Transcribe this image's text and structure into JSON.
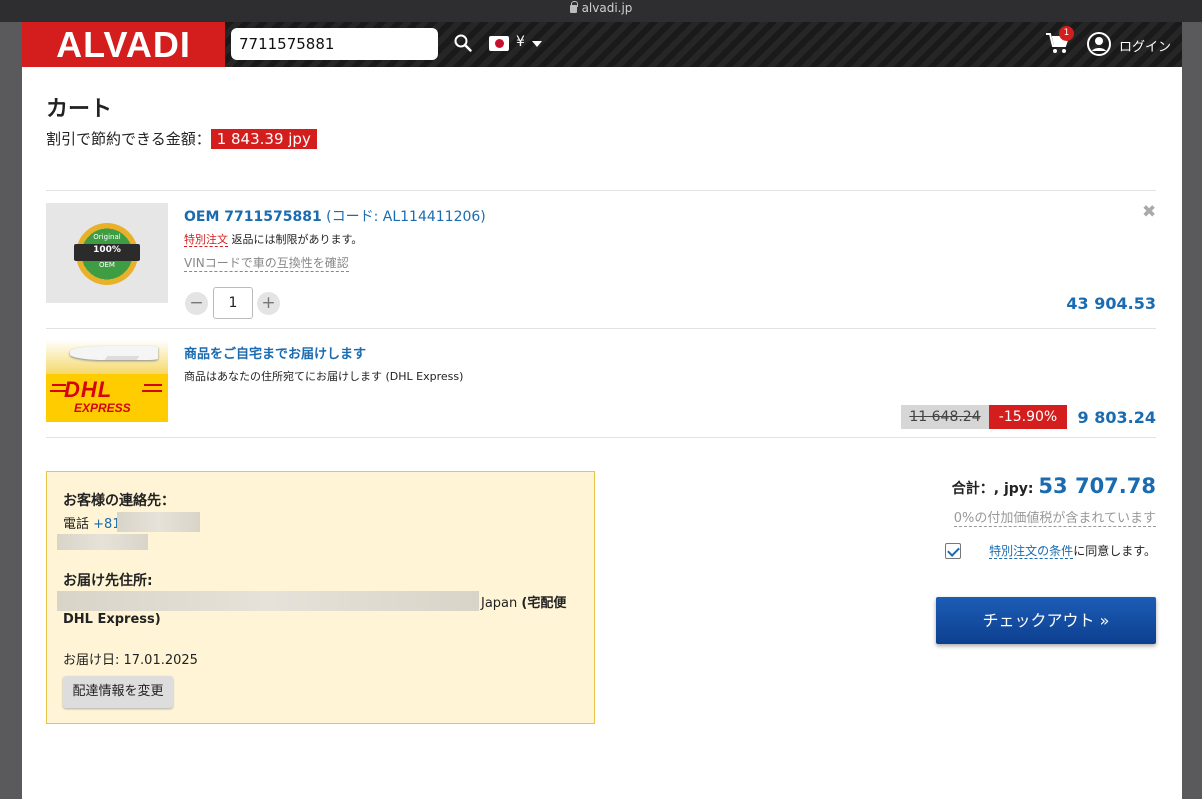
{
  "browser": {
    "url": "alvadi.jp"
  },
  "header": {
    "logo": "ALVADI",
    "search_value": "7711575881",
    "currency": "¥",
    "cart_count": "1",
    "login_label": "ログイン"
  },
  "page": {
    "title": "カート",
    "savings_label": "割引で節約できる金額：",
    "savings_amount": "1 843.39 jpy"
  },
  "item": {
    "badge_top": "Original",
    "badge_mid": "100%",
    "badge_bottom": "OEM",
    "title_bold": "OEM 7711575881",
    "title_code": "(コード: AL114411206)",
    "special_label": "特別注文",
    "special_text": "返品には制限があります。",
    "vin_link": "VINコードで車の互換性を確認",
    "quantity": "1",
    "price": "43 904.53"
  },
  "delivery": {
    "logo_text": "DHL",
    "logo_sub": "EXPRESS",
    "title": "商品をご自宅までお届けします",
    "description": "商品はあなたの住所宛てにお届けします (DHL Express)",
    "old_price": "11 648.24",
    "discount": "-15.90%",
    "price": "9 803.24"
  },
  "contact": {
    "heading": "お客様の連絡先：",
    "phone_label": "電話",
    "phone_prefix": "+81",
    "address_heading": "お届け先住所:",
    "address_country": "Japan",
    "address_method": "(宅配便",
    "address_method2": "DHL Express)",
    "delivery_date": "お届け日: 17.01.2025",
    "change_button": "配達情報を変更"
  },
  "summary": {
    "total_label": "合計：, jpy:",
    "total_amount": "53 707.78",
    "vat_note": "0%の付加価値税が含まれています",
    "terms_link": "特別注文の条件",
    "terms_suffix": "に同意します。",
    "checkout_label": "チェックアウト »"
  }
}
